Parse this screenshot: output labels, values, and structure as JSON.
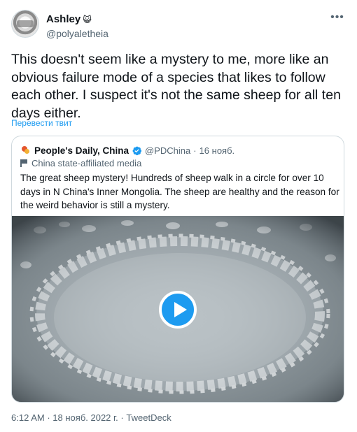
{
  "tweet": {
    "author": {
      "display_name": "Ashley",
      "emoji": "😺",
      "handle": "@polyaletheia"
    },
    "more_icon": "more-icon",
    "text": "This doesn't seem like a mystery to me, more like an obvious failure mode of a species that likes to follow each other. I suspect it's not the same sheep for all ten days either.",
    "translate_label": "Перевести твит",
    "quote": {
      "name": "People's Daily, China",
      "handle": "@PDChina",
      "separator": "·",
      "date": "16 нояб.",
      "affiliation": "China state-affiliated media",
      "text": "The great sheep mystery! Hundreds of sheep walk in a circle for over 10 days in N China's Inner Mongolia. The sheep are healthy and the reason for the weird behavior is still a mystery.",
      "verified_icon": "verified-badge-icon",
      "media": {
        "type": "video",
        "play_icon": "play-icon",
        "accent": "#1d9bf0"
      }
    },
    "meta": {
      "time": "6:12 AM",
      "separator": "·",
      "date": "18 нояб. 2022 г.",
      "source": "TweetDeck"
    }
  }
}
